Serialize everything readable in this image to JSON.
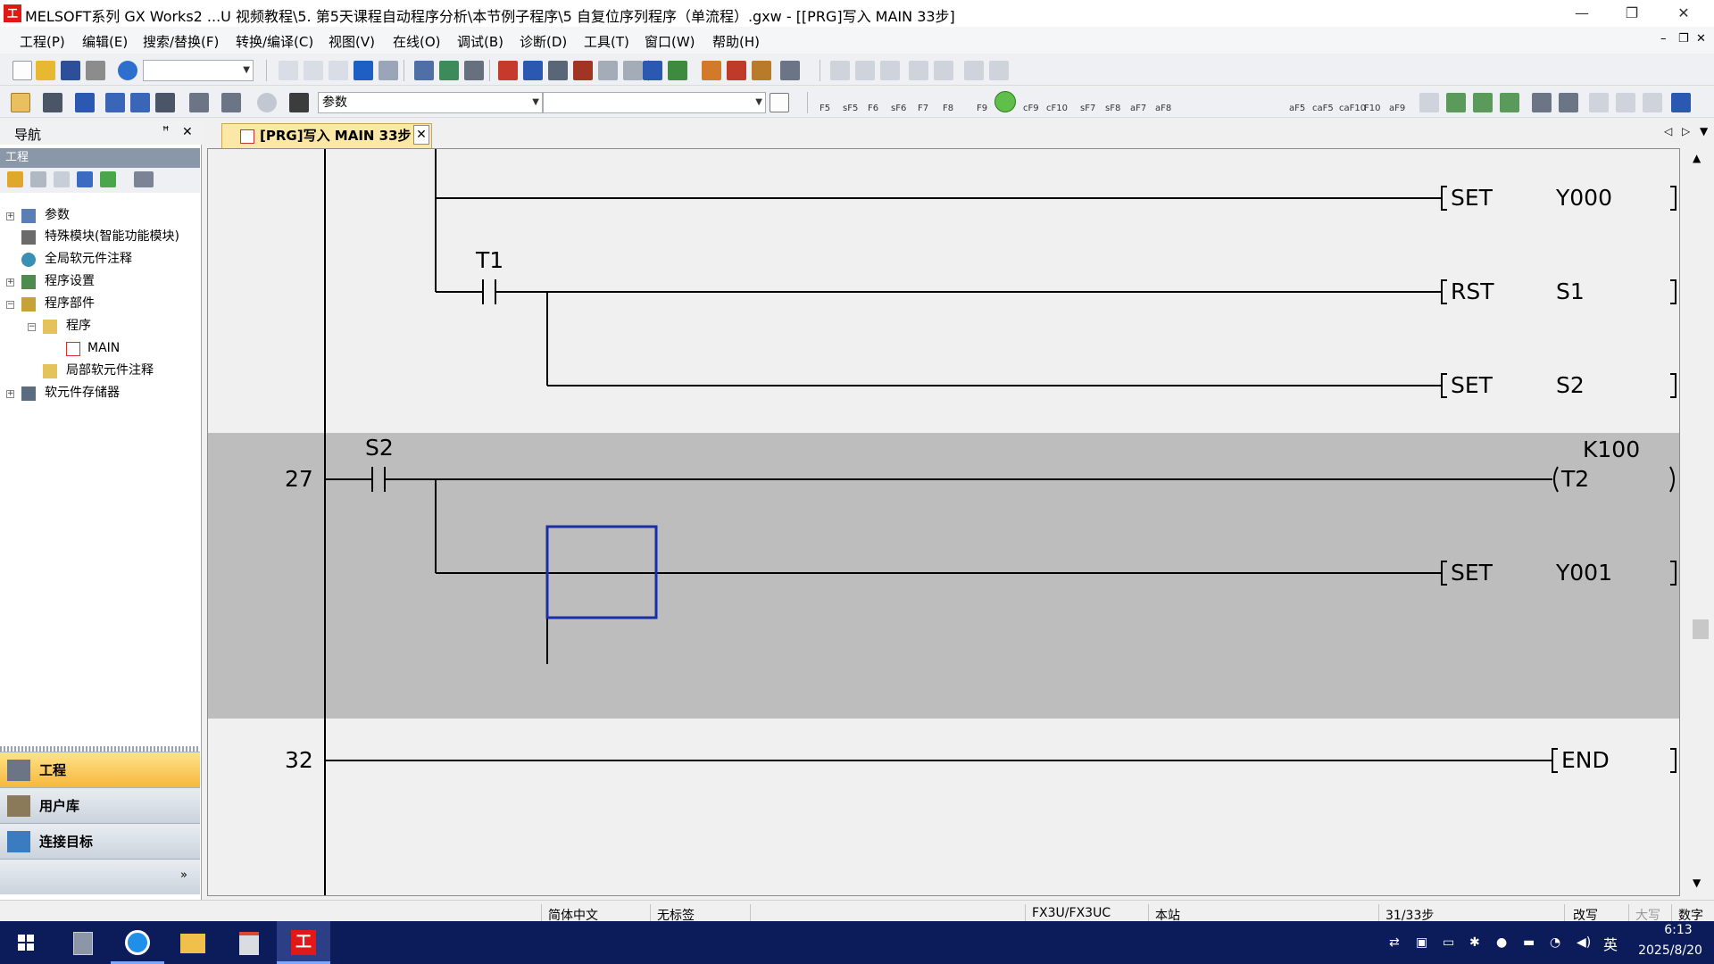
{
  "window": {
    "title": "MELSOFT系列 GX Works2 ...U 视频教程\\5. 第5天课程自动程序分析\\本节例子程序\\5 自复位序列程序（单流程）.gxw - [[PRG]写入 MAIN 33步]",
    "app_icon_glyph": "工"
  },
  "menu": [
    "工程(P)",
    "编辑(E)",
    "搜索/替换(F)",
    "转换/编译(C)",
    "视图(V)",
    "在线(O)",
    "调试(B)",
    "诊断(D)",
    "工具(T)",
    "窗口(W)",
    "帮助(H)"
  ],
  "toolbar": {
    "param_combo": "参数",
    "fkeys": [
      "F5",
      "sF5",
      "F6",
      "sF6",
      "F7",
      "F8",
      "F9",
      "cF9",
      "cF10",
      "sF7",
      "sF8",
      "aF7",
      "aF8",
      "aF5",
      "caF5",
      "caF10",
      "F10",
      "aF9"
    ]
  },
  "nav": {
    "title": "导航",
    "pin_glyph": "ꟸ",
    "close_glyph": "✕",
    "section": "工程",
    "tree": [
      {
        "label": "参数",
        "level": 0,
        "expander": "+"
      },
      {
        "label": "特殊模块(智能功能模块)",
        "level": 0,
        "expander": ""
      },
      {
        "label": "全局软元件注释",
        "level": 0,
        "expander": ""
      },
      {
        "label": "程序设置",
        "level": 0,
        "expander": "+"
      },
      {
        "label": "程序部件",
        "level": 0,
        "expander": "−"
      },
      {
        "label": "程序",
        "level": 1,
        "expander": "−"
      },
      {
        "label": "MAIN",
        "level": 2,
        "expander": ""
      },
      {
        "label": "局部软元件注释",
        "level": 1,
        "expander": ""
      },
      {
        "label": "软元件存储器",
        "level": 0,
        "expander": "+"
      }
    ],
    "tabs": [
      "工程",
      "用户库",
      "连接目标"
    ]
  },
  "editor": {
    "tab_title": "[PRG]写入 MAIN 33步",
    "rungs": {
      "set_y000": {
        "instr": "SET",
        "operand": "Y000"
      },
      "t1_contact": "T1",
      "rst_s1": {
        "instr": "RST",
        "operand": "S1"
      },
      "set_s2": {
        "instr": "SET",
        "operand": "S2"
      },
      "step27": "27",
      "s2_contact": "S2",
      "t2_coil": {
        "operand": "T2",
        "constant": "K100"
      },
      "set_y001": {
        "instr": "SET",
        "operand": "Y001"
      },
      "step32": "32",
      "end": "END"
    }
  },
  "status": {
    "language": "简体中文",
    "title_status": "无标签",
    "plc_type": "FX3U/FX3UC",
    "station": "本站",
    "steps": "31/33步",
    "mode": "改写",
    "caps": "大写",
    "num": "数字"
  },
  "taskbar": {
    "ime": "英",
    "time": "6:13",
    "date": "2025/8/20"
  },
  "colors": {
    "selected_block_bg": "#bdbdbd",
    "cursor_border": "#1a2ea8",
    "nav_active_tab": "#f6b83c",
    "taskbar": "#0c1b5a"
  }
}
